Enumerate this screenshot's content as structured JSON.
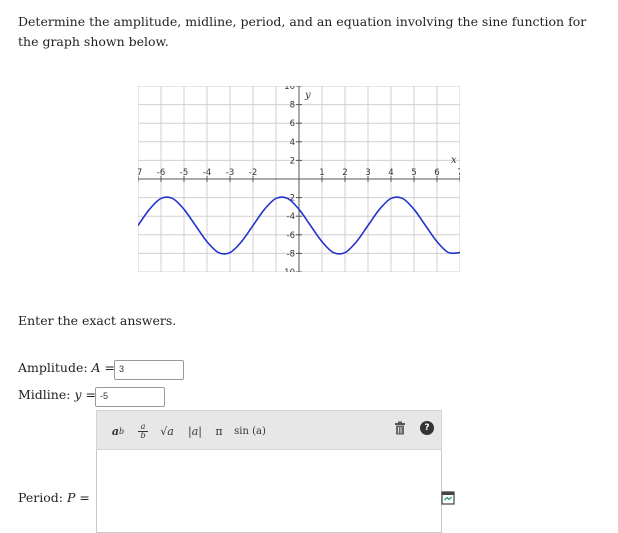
{
  "question": {
    "prompt": "Determine the amplitude, midline, period, and an equation involving the sine function for the graph shown below.",
    "instructions": "Enter the exact answers."
  },
  "graph": {
    "x_axis_label": "x",
    "y_axis_label": "y",
    "x_tick_labels": [
      "-7",
      "-6",
      "-5",
      "-4",
      "-3",
      "-2",
      "1",
      "2",
      "3",
      "4",
      "5",
      "6",
      "7"
    ],
    "y_tick_labels": [
      "10",
      "8",
      "6",
      "4",
      "2",
      "-2",
      "-4",
      "-6",
      "-8",
      "-10"
    ]
  },
  "chart_data": {
    "type": "line",
    "xlim": [
      -7,
      7
    ],
    "ylim": [
      -10,
      10
    ],
    "grid": true,
    "xlabel": "x",
    "ylabel": "y",
    "curve_color": "#2233cc",
    "x": [
      -7,
      -6.5,
      -6,
      -5.5,
      -5,
      -4.5,
      -4,
      -3.5,
      -3,
      -2.5,
      -2,
      -1.5,
      -1,
      -0.5,
      0,
      0.5,
      1,
      1.5,
      2,
      2.5,
      3,
      3.5,
      4,
      4.5,
      5,
      5.5,
      6,
      6.5,
      7
    ],
    "y": [
      -5,
      -3.26,
      -2.09,
      -2.09,
      -3.26,
      -5,
      -6.74,
      -7.91,
      -7.91,
      -6.74,
      -5,
      -3.26,
      -2.09,
      -2.09,
      -3.26,
      -5,
      -6.74,
      -7.91,
      -7.91,
      -6.74,
      -5,
      -3.26,
      -2.09,
      -2.09,
      -3.26,
      -5,
      -6.74,
      -7.91,
      -7.91
    ]
  },
  "answers": {
    "amplitude_label": "Amplitude:",
    "amplitude_var": "A",
    "amplitude_value": "3",
    "midline_label": "Midline:",
    "midline_var": "y",
    "midline_value": "-5",
    "period_label": "Period:",
    "period_var": "P"
  },
  "toolbar": {
    "power_label": "a",
    "power_sup": "b",
    "frac_num": "a",
    "frac_den": "b",
    "sqrt_label": "√a",
    "abs_label": "|a|",
    "pi_label": "π",
    "sin_label": "sin (a)",
    "help_label": "?"
  }
}
